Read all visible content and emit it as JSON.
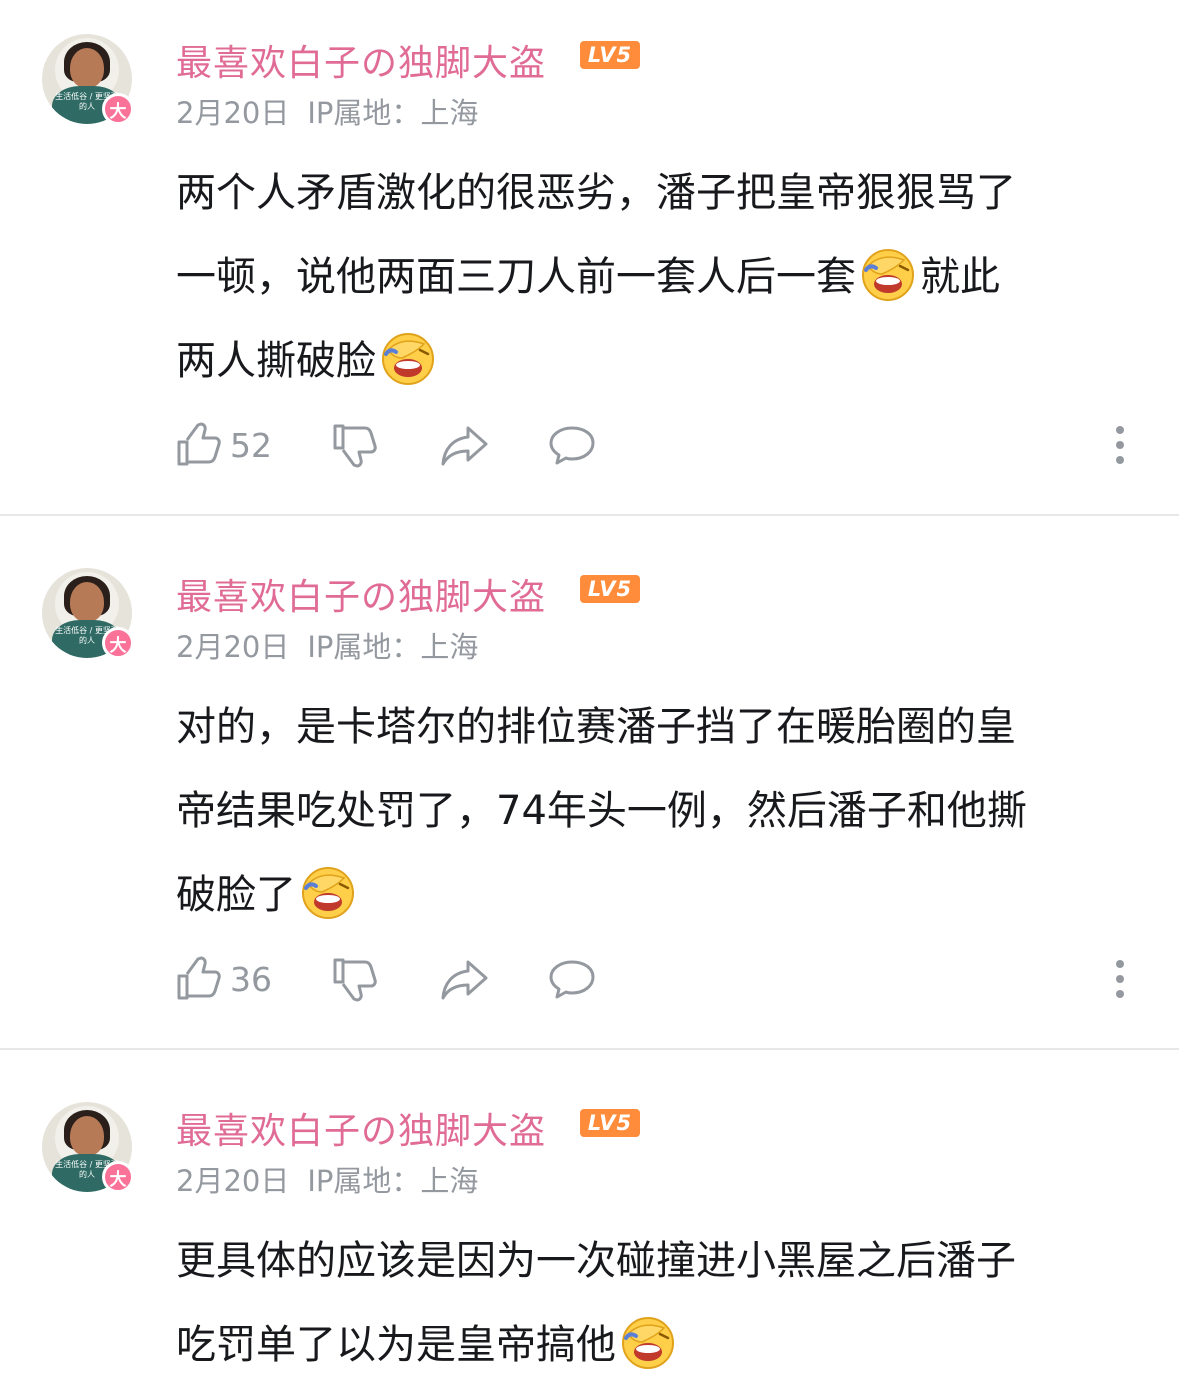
{
  "comments": [
    {
      "username": "最喜欢白子の独脚大盗",
      "level": "LV5",
      "avatar_badge": "大",
      "avatar_caption": "生活低谷 / 更坚强的人",
      "date": "2月20日",
      "ip": "IP属地：上海",
      "lines": [
        "两个人矛盾激化的很恶劣，潘子把皇帝狠狠骂了",
        "一顿，说他两面三刀人前一套人后一套",
        "就此",
        "两人撕破脸"
      ],
      "likes": "52"
    },
    {
      "username": "最喜欢白子の独脚大盗",
      "level": "LV5",
      "avatar_badge": "大",
      "avatar_caption": "生活低谷 / 更坚强的人",
      "date": "2月20日",
      "ip": "IP属地：上海",
      "lines": [
        "对的，是卡塔尔的排位赛潘子挡了在暖胎圈的皇",
        "帝结果吃处罚了，74年头一例，然后潘子和他撕",
        "破脸了"
      ],
      "likes": "36"
    },
    {
      "username": "最喜欢白子の独脚大盗",
      "level": "LV5",
      "avatar_badge": "大",
      "avatar_caption": "生活低谷 / 更坚强的人",
      "date": "2月20日",
      "ip": "IP属地：上海",
      "lines": [
        "更具体的应该是因为一次碰撞进小黑屋之后潘子",
        "吃罚单了以为是皇帝搞他"
      ]
    }
  ],
  "icons": {
    "like": "thumbs-up-icon",
    "dislike": "thumbs-down-icon",
    "share": "share-icon",
    "reply": "reply-bubble-icon",
    "more": "more-vertical-icon",
    "emoji": "facepalm-laugh-emoji"
  },
  "colors": {
    "username": "#e06c96",
    "level_badge": "#ff8c3a",
    "avatar_badge": "#fb7299",
    "meta": "#9499a0"
  }
}
